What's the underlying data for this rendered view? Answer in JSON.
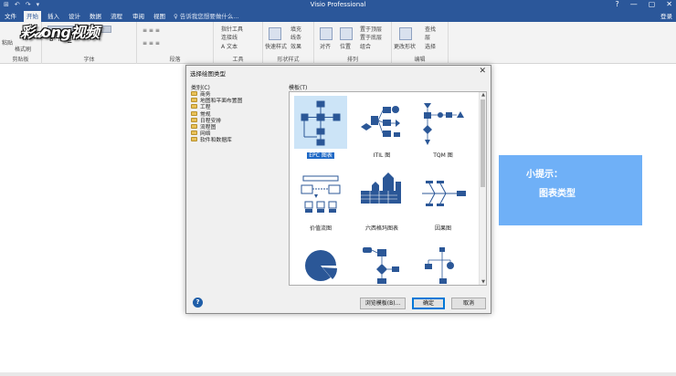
{
  "titlebar": {
    "app_title": "Visio Professional",
    "qat": [
      "⊞",
      "↶",
      "↷",
      "▾"
    ],
    "winctl": [
      "?",
      "—",
      "▢",
      "✕"
    ]
  },
  "tabs": [
    "文件",
    "开始",
    "插入",
    "设计",
    "数据",
    "流程",
    "审阅",
    "视图"
  ],
  "active_tab": "开始",
  "tellme": "♀ 告诉我您想要做什么...",
  "signin": "登录",
  "ribbon": {
    "groups": {
      "clipboard": "剪贴板",
      "font": "字体",
      "paragraph": "段落",
      "tools": "工具",
      "shape_styles": "形状样式",
      "arrange": "排列",
      "edit": "编辑"
    },
    "items": {
      "paste": "粘贴",
      "format_painter": "格式刷",
      "pointer": "指针工具",
      "connector": "连接线",
      "text": "A 文本",
      "quick_styles": "快速样式",
      "fill": "填充",
      "line": "线条",
      "effects": "效果",
      "align": "对齐",
      "position": "位置",
      "bring_front": "置于顶层",
      "send_back": "置于底层",
      "group": "组合",
      "change_shape": "更改形状",
      "find": "查找",
      "layers": "层",
      "select": "选择"
    }
  },
  "logo_text": "彩𝒹ong视频",
  "dialog": {
    "title": "选择绘图类型",
    "close": "✕",
    "category_label": "类别(C)",
    "template_label": "模板(T)",
    "categories": [
      "商务",
      "地图和平面布置图",
      "工程",
      "常规",
      "日程安排",
      "流程图",
      "网络",
      "软件和数据库"
    ],
    "templates": [
      {
        "name": "EPC 图表",
        "selected": true
      },
      {
        "name": "ITIL 图",
        "selected": false
      },
      {
        "name": "TQM 图",
        "selected": false
      },
      {
        "name": "价值流图",
        "selected": false
      },
      {
        "name": "六西格玛图表",
        "selected": false
      },
      {
        "name": "因果图",
        "selected": false
      }
    ],
    "buttons": {
      "help": "?",
      "browse": "浏览模板(B)...",
      "ok": "确定",
      "cancel": "取消"
    }
  },
  "hint": {
    "line1": "小提示：",
    "line2": "图表类型"
  },
  "colors": {
    "brand": "#2b579a",
    "shape_blue": "#2b5797",
    "hint_bg": "#6fb0f7",
    "selection": "#cce4f7"
  }
}
